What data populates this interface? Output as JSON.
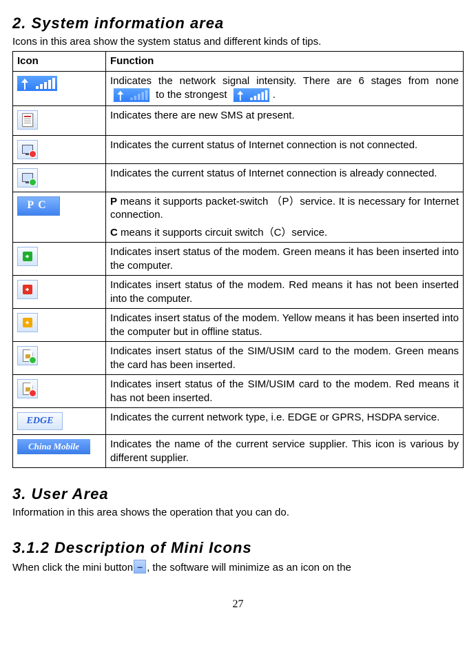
{
  "section2": {
    "title": "2. System information area",
    "intro": "Icons in this area show the system status and different kinds of tips.",
    "headers": {
      "icon": "Icon",
      "func": "Function"
    },
    "rows": [
      {
        "pre": "Indicates the network signal intensity. There are 6 stages from none",
        "mid": " to the strongest",
        "post": "."
      },
      {
        "text": "Indicates there are new SMS at present."
      },
      {
        "text": "Indicates the current status of Internet connection is not connected."
      },
      {
        "text": "Indicates the current status of Internet connection is already connected."
      },
      {
        "p_label": "P",
        "p_text": " means it supports packet-switch （P）service. It is necessary for Internet connection.",
        "c_label": "C",
        "c_text": " means it supports circuit switch（C）service."
      },
      {
        "text": "Indicates insert status of the modem. Green means it has been inserted into the computer."
      },
      {
        "text": "Indicates insert status of the modem.  Red means it has not been inserted into the computer."
      },
      {
        "text": "Indicates insert status of the modem.  Yellow means it has been inserted into the computer but in offline status."
      },
      {
        "text": "Indicates insert status of the SIM/USIM card to the modem. Green means the card has been inserted."
      },
      {
        "text": "Indicates insert status of the SIM/USIM card to the modem. Red means it has not been inserted."
      },
      {
        "text": "Indicates the current network type, i.e. EDGE or GPRS, HSDPA service."
      },
      {
        "text": "Indicates the name of the current service supplier. This icon is various by different supplier."
      }
    ],
    "edge_label": "EDGE",
    "supplier_label": "China Mobile",
    "pc_label": "PC"
  },
  "section3": {
    "title": "3. User Area",
    "intro": "Information in this area shows the operation that you can do."
  },
  "section312": {
    "title": "3.1.2 Description of Mini Icons",
    "pre": "When click the mini button",
    "post": ", the software will minimize as an icon on the",
    "mini_symbol": "–"
  },
  "page_number": "27"
}
